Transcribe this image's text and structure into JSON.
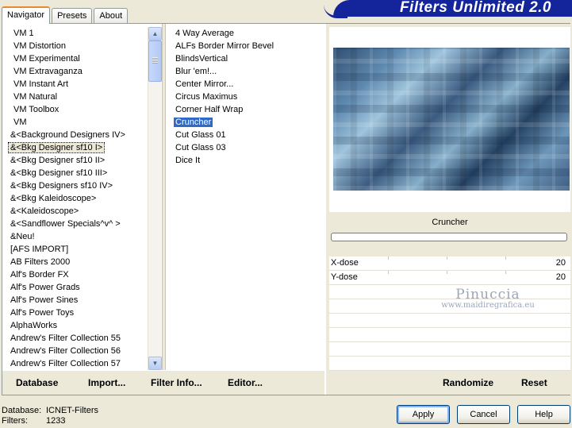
{
  "tabs": [
    "Navigator",
    "Presets",
    "About"
  ],
  "banner_title": "Filters Unlimited 2.0",
  "categories": [
    "VM 1",
    "VM Distortion",
    "VM Experimental",
    "VM Extravaganza",
    "VM Instant Art",
    "VM Natural",
    "VM Toolbox",
    "VM",
    "&<Background Designers IV>",
    "&<Bkg Designer sf10 I>",
    "&<Bkg Designer sf10 II>",
    "&<Bkg Designer sf10 III>",
    "&<Bkg Designers sf10 IV>",
    "&<Bkg Kaleidoscope>",
    "&<Kaleidoscope>",
    "&<Sandflower Specials^v^ >",
    "&Neu!",
    "[AFS IMPORT]",
    "AB Filters 2000",
    "Alf's Border FX",
    "Alf's Power Grads",
    "Alf's Power Sines",
    "Alf's Power Toys",
    "AlphaWorks",
    "Andrew's Filter Collection 55",
    "Andrew's Filter Collection 56",
    "Andrew's Filter Collection 57"
  ],
  "focused_category": "&<Bkg Designer sf10 I>",
  "filters": [
    "4 Way Average",
    "ALFs Border Mirror Bevel",
    "BlindsVertical",
    "Blur 'em!...",
    "Center Mirror...",
    "Circus Maximus",
    "Corner Half Wrap",
    "Cruncher",
    "Cut Glass 01",
    "Cut Glass 03",
    "Dice It"
  ],
  "selected_filter": "Cruncher",
  "preview": {
    "filter_name": "Cruncher",
    "progress": 0
  },
  "params": [
    {
      "label": "X-dose",
      "value": "20"
    },
    {
      "label": "Y-dose",
      "value": "20"
    }
  ],
  "watermark": {
    "name": "Pinuccia",
    "url": "www.maidiregrafica.eu"
  },
  "toolbar": {
    "database": "Database",
    "import": "Import...",
    "filter_info": "Filter Info...",
    "editor": "Editor...",
    "randomize": "Randomize",
    "reset": "Reset"
  },
  "status": {
    "database_label": "Database:",
    "database_value": "ICNET-Filters",
    "filters_label": "Filters:",
    "filters_value": "1233"
  },
  "buttons": {
    "apply": "Apply",
    "cancel": "Cancel",
    "help": "Help"
  },
  "colors": {
    "banner": "#14249a",
    "selection": "#316ac5",
    "tab_accent": "#e68b2c"
  }
}
